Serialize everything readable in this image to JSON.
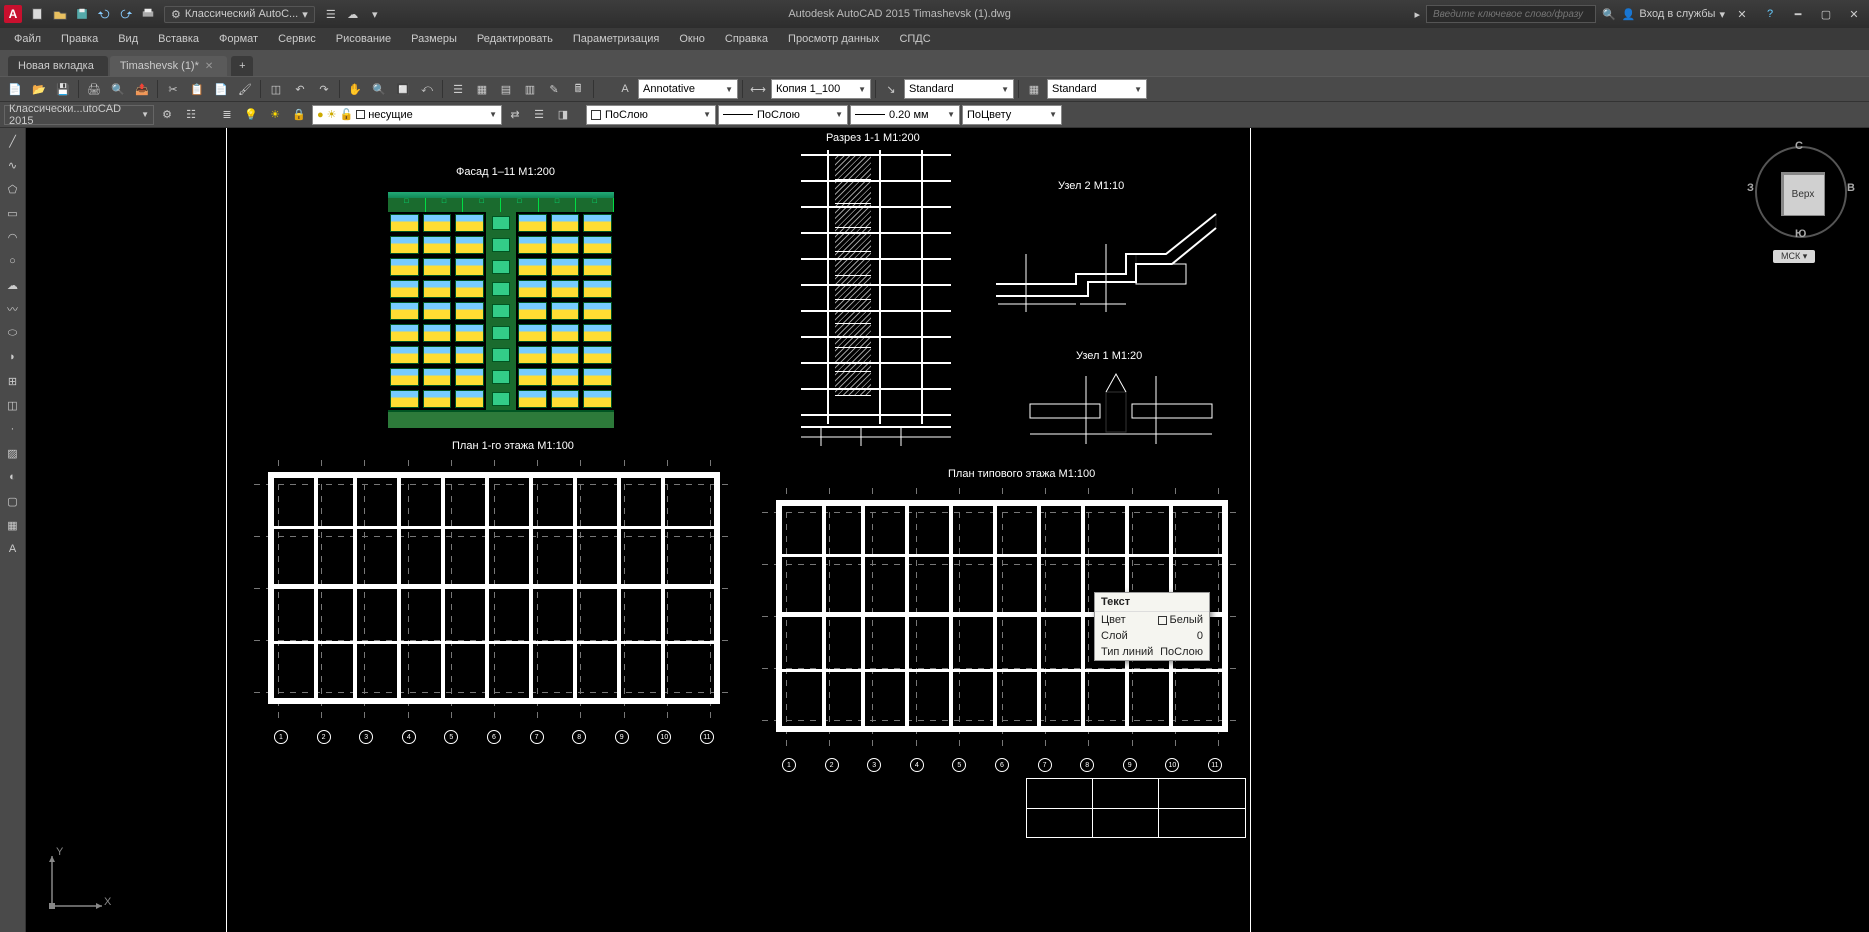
{
  "app": {
    "title": "Autodesk AutoCAD 2015   Timashevsk (1).dwg",
    "logo_letter": "A"
  },
  "workspace_picker": "Классический AutoC...",
  "search_placeholder": "Введите ключевое слово/фразу",
  "signin_label": "Вход в службы",
  "menubar": [
    "Файл",
    "Правка",
    "Вид",
    "Вставка",
    "Формат",
    "Сервис",
    "Рисование",
    "Размеры",
    "Редактировать",
    "Параметризация",
    "Окно",
    "Справка",
    "Просмотр данных",
    "СПДС"
  ],
  "tabs": [
    {
      "label": "Новая вкладка",
      "active": false
    },
    {
      "label": "Timashevsk (1)*",
      "active": true
    }
  ],
  "styles_bar": {
    "text_style": "Annotative",
    "dim_style": "Копия 1_100",
    "mleader_style": "Standard",
    "table_style": "Standard"
  },
  "props_bar": {
    "workspace_combo": "Классически...utoCAD 2015",
    "layer_combo": "несущие",
    "color_combo": "ПоСлою",
    "linetype_combo": "ПоСлою",
    "lineweight_combo": "0.20 мм",
    "plotstyle_combo": "ПоЦвету"
  },
  "viewcube": {
    "top": "Верх",
    "n": "С",
    "e": "В",
    "s": "Ю",
    "w": "З",
    "wcs": "МСК"
  },
  "ucs": {
    "x": "X",
    "y": "Y"
  },
  "drawing_titles": {
    "facade": "Фасад 1–11 М1:200",
    "section": "Разрез 1-1 М1:200",
    "node2": "Узел 2 М1:10",
    "node1": "Узел 1 М1:20",
    "plan1": "План 1-го этажа М1:100",
    "plan_typ": "План типового этажа М1:100"
  },
  "tooltip": {
    "title": "Текст",
    "rows": {
      "color_label": "Цвет",
      "color_value": "Белый",
      "layer_label": "Слой",
      "layer_value": "0",
      "ltype_label": "Тип линий",
      "ltype_value": "ПоСлою"
    }
  },
  "grid_bubbles": [
    "1",
    "2",
    "3",
    "4",
    "5",
    "6",
    "7",
    "8",
    "9",
    "10",
    "11"
  ]
}
